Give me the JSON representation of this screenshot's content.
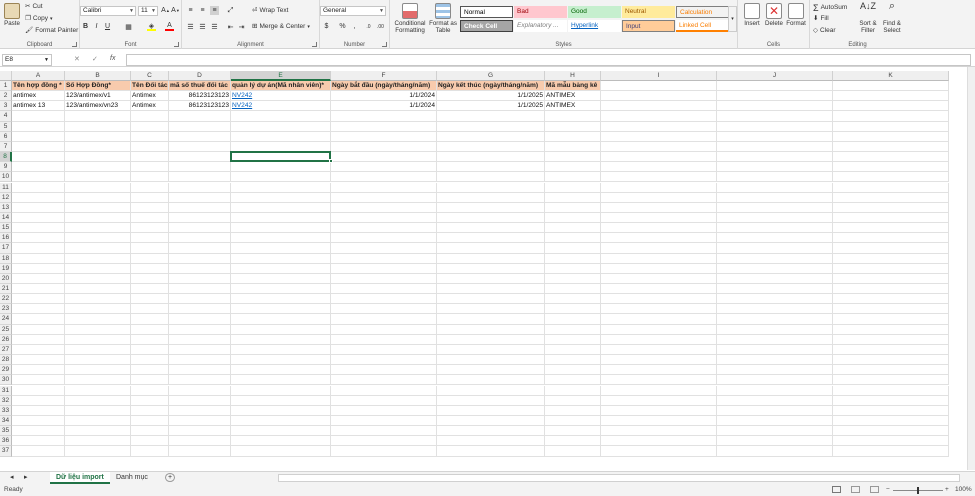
{
  "ribbon": {
    "clipboard": {
      "label": "Clipboard",
      "paste": "Paste",
      "cut": "Cut",
      "copy": "Copy",
      "format_painter": "Format Painter"
    },
    "font": {
      "label": "Font",
      "name": "Calibri",
      "size": "11"
    },
    "alignment": {
      "label": "Alignment",
      "wrap_text": "Wrap Text",
      "merge_center": "Merge & Center"
    },
    "number": {
      "label": "Number",
      "format": "General"
    },
    "styles": {
      "label": "Styles",
      "conditional_formatting": "Conditional Formatting",
      "format_as_table": "Format as Table",
      "gallery": [
        {
          "name": "Normal",
          "bg": "#ffffff",
          "fg": "#000000"
        },
        {
          "name": "Bad",
          "bg": "#ffc7ce",
          "fg": "#9c0006"
        },
        {
          "name": "Good",
          "bg": "#c6efce",
          "fg": "#006100"
        },
        {
          "name": "Neutral",
          "bg": "#ffeb9c",
          "fg": "#9c5700"
        },
        {
          "name": "Calculation",
          "bg": "#f2f2f2",
          "fg": "#fa7d00"
        },
        {
          "name": "Check Cell",
          "bg": "#a5a5a5",
          "fg": "#ffffff"
        },
        {
          "name": "Explanatory ...",
          "bg": "#ffffff",
          "fg": "#7f7f7f"
        },
        {
          "name": "Hyperlink",
          "bg": "#ffffff",
          "fg": "#0563c1"
        },
        {
          "name": "Input",
          "bg": "#ffcc99",
          "fg": "#3f3f76"
        },
        {
          "name": "Linked Cell",
          "bg": "#ffffff",
          "fg": "#fa7d00"
        }
      ]
    },
    "cells": {
      "label": "Cells",
      "insert": "Insert",
      "delete": "Delete",
      "format": "Format"
    },
    "editing": {
      "label": "Editing",
      "autosum": "AutoSum",
      "fill": "Fill",
      "clear": "Clear",
      "sort_filter": "Sort & Filter",
      "find_select": "Find & Select"
    }
  },
  "formula_bar": {
    "name_box": "E8",
    "fx": "fx",
    "content": ""
  },
  "sheet": {
    "columns": [
      "A",
      "B",
      "C",
      "D",
      "E",
      "F",
      "G",
      "H",
      "I",
      "J",
      "K"
    ],
    "row_count": 37,
    "header_fill": "#f8cbad",
    "headers": [
      "Tên hợp đồng *",
      "Số Hợp Đồng*",
      "Tên Đối tác",
      "mã số thuế đối tác",
      "quản lý dự án(Mã nhân viên)*",
      "Ngày bắt đầu (ngày/tháng/năm)",
      "Ngày kết thúc (ngày/tháng/năm)",
      "Mã mẫu bảng kê"
    ],
    "rows": [
      [
        "antimex",
        "123/antimex/v1",
        "Antimex",
        "86123123123",
        "NV242",
        "1/1/2024",
        "1/1/2025",
        "ANTIMEX"
      ],
      [
        "antimex 13",
        "123/antimex/vn23",
        "Antimex",
        "86123123123",
        "NV242",
        "1/1/2024",
        "1/1/2025",
        "ANTIMEX"
      ]
    ],
    "selected_cell": "E8"
  },
  "tabs": {
    "items": [
      "Dữ liệu import",
      "Danh mục"
    ],
    "active": 0,
    "add": "+"
  },
  "status": {
    "ready": "Ready",
    "zoom": "100%"
  }
}
